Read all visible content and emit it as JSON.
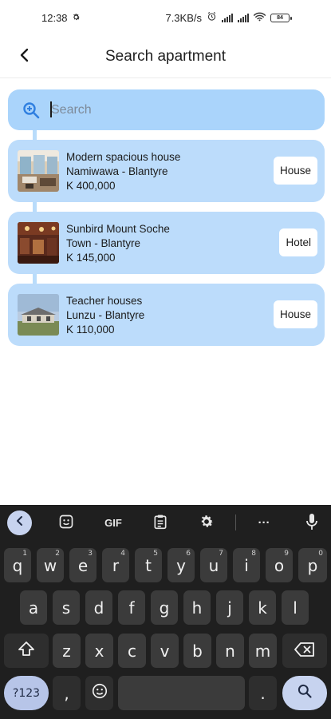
{
  "status_bar": {
    "time": "12:38",
    "network_speed": "7.3KB/s",
    "signal_label": "4G",
    "battery": "84",
    "icons": [
      "gear-icon",
      "alarm-icon",
      "signal-icon",
      "signal-icon",
      "wifi-icon",
      "battery-icon"
    ]
  },
  "app_bar": {
    "title": "Search apartment",
    "back_icon": "chevron-left-icon"
  },
  "search": {
    "placeholder": "Search",
    "value": "",
    "icon": "search-icon"
  },
  "listings": [
    {
      "name": "Modern spacious house",
      "location": "Namiwawa - Blantyre",
      "price": "K 400,000",
      "type": "House"
    },
    {
      "name": "Sunbird Mount Soche",
      "location": "Town - Blantyre",
      "price": "K 145,000",
      "type": "Hotel"
    },
    {
      "name": "Teacher houses",
      "location": "Lunzu - Blantyre",
      "price": "K 110,000",
      "type": "House"
    }
  ],
  "keyboard": {
    "toolbar": {
      "gif_label": "GIF",
      "more_label": "···",
      "icons": [
        "chevron-left-icon",
        "sticker-icon",
        "clipboard-icon",
        "gear-icon",
        "microphone-icon"
      ]
    },
    "row1": [
      {
        "key": "q",
        "hint": "1"
      },
      {
        "key": "w",
        "hint": "2"
      },
      {
        "key": "e",
        "hint": "3"
      },
      {
        "key": "r",
        "hint": "4"
      },
      {
        "key": "t",
        "hint": "5"
      },
      {
        "key": "y",
        "hint": "6"
      },
      {
        "key": "u",
        "hint": "7"
      },
      {
        "key": "i",
        "hint": "8"
      },
      {
        "key": "o",
        "hint": "9"
      },
      {
        "key": "p",
        "hint": "0"
      }
    ],
    "row2": [
      "a",
      "s",
      "d",
      "f",
      "g",
      "h",
      "j",
      "k",
      "l"
    ],
    "row3": [
      "z",
      "x",
      "c",
      "v",
      "b",
      "n",
      "m"
    ],
    "symbols_label": "?123",
    "comma": ",",
    "period": "."
  },
  "colors": {
    "card_bg": "#bcdcfb",
    "search_bg": "#aad4fb",
    "accent_icon": "#2f7fe0",
    "keyboard_bg": "#1f1f1f",
    "key_bg": "#3b3b3b"
  }
}
